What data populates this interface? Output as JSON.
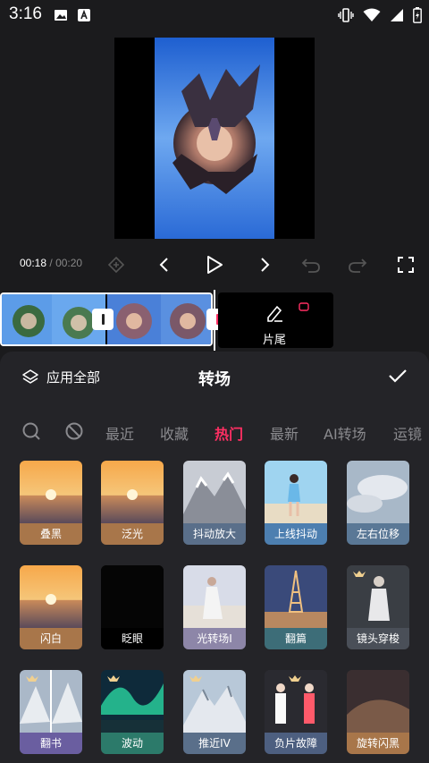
{
  "status_bar": {
    "time": "3:16"
  },
  "controls": {
    "time_current": "00:18",
    "time_separator": "/",
    "time_total": "00:20"
  },
  "timeline": {
    "ending_label": "片尾"
  },
  "panel": {
    "apply_all_label": "应用全部",
    "title": "转场",
    "categories": [
      "最近",
      "收藏",
      "热门",
      "最新",
      "AI转场",
      "运镜"
    ],
    "active_category": "热门",
    "tiles": [
      {
        "label": "叠黑",
        "label_bg": "#a8764a"
      },
      {
        "label": "泛光",
        "label_bg": "#a8764a"
      },
      {
        "label": "抖动放大",
        "label_bg": "#5a6f8a"
      },
      {
        "label": "上线抖动",
        "label_bg": "#4d7fb0"
      },
      {
        "label": "左右位移",
        "label_bg": "#5a7896"
      },
      {
        "label": "闪白",
        "label_bg": "#a8764a"
      },
      {
        "label": "眨眼",
        "label_bg": "#000000"
      },
      {
        "label": "光转场I",
        "label_bg": "#8d86a8"
      },
      {
        "label": "翻篇",
        "label_bg": "#3d6d78"
      },
      {
        "label": "镜头穿梭",
        "label_bg": "#4a4f58"
      },
      {
        "label": "翻书",
        "label_bg": "#6a5ea0"
      },
      {
        "label": "波动",
        "label_bg": "#2c7a6a"
      },
      {
        "label": "推近IV",
        "label_bg": "#5a6f8a"
      },
      {
        "label": "负片故障",
        "label_bg": "#4d5f80"
      },
      {
        "label": "旋转闪黑",
        "label_bg": "#a8764a"
      }
    ]
  },
  "colors": {
    "accent": "#ff2f63",
    "panel_bg": "#242428",
    "app_bg": "#1b1b1d"
  }
}
